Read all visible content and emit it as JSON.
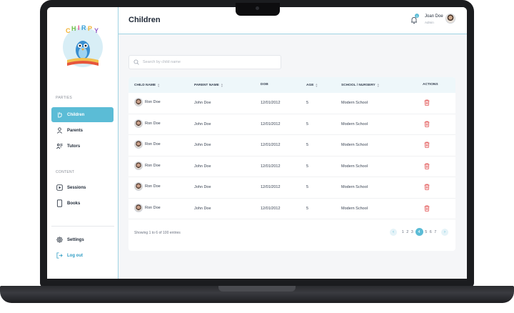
{
  "sidebar": {
    "sections": [
      {
        "label": "PARTIES"
      },
      {
        "label": "CONTENT"
      }
    ],
    "items": [
      {
        "label": "Children",
        "icon": "hand-icon",
        "active": true
      },
      {
        "label": "Parents",
        "icon": "parent-icon"
      },
      {
        "label": "Tutors",
        "icon": "tutor-icon"
      },
      {
        "label": "Sessions",
        "icon": "play-icon"
      },
      {
        "label": "Books",
        "icon": "book-icon"
      }
    ],
    "settings_label": "Settings",
    "logout_label": "Log out"
  },
  "header": {
    "title": "Children",
    "notification_count": "1",
    "user_name": "Joan Doe",
    "user_role": "Admin"
  },
  "search": {
    "placeholder": "Search by child name",
    "value": ""
  },
  "table": {
    "headers": [
      "CHILD NAME",
      "PARENT NAME",
      "DOB",
      "AGE",
      "SCHOOL / NURSERY",
      "ACTIONS"
    ],
    "rows": [
      {
        "child": "Ron Doe",
        "parent": "John Doe",
        "dob": "12/01/2012",
        "age": "5",
        "school": "Modern School"
      },
      {
        "child": "Ron Doe",
        "parent": "John Doe",
        "dob": "12/01/2012",
        "age": "5",
        "school": "Modern School"
      },
      {
        "child": "Ron Doe",
        "parent": "John Doe",
        "dob": "12/01/2012",
        "age": "5",
        "school": "Modern School"
      },
      {
        "child": "Ron Doe",
        "parent": "John Doe",
        "dob": "12/01/2012",
        "age": "5",
        "school": "Modern School"
      },
      {
        "child": "Ron Doe",
        "parent": "John Doe",
        "dob": "12/01/2012",
        "age": "5",
        "school": "Modern School"
      },
      {
        "child": "Ron Doe",
        "parent": "John Doe",
        "dob": "12/01/2012",
        "age": "5",
        "school": "Modern School"
      }
    ],
    "footer": "Showing 1 to 6 of 100 entries"
  },
  "pagination": {
    "prev": "‹",
    "next": "›",
    "pages": [
      "1",
      "2",
      "3",
      "4",
      "5",
      "6",
      "7"
    ],
    "current": "4"
  },
  "colors": {
    "accent": "#5bbcd6",
    "danger": "#e04a4a",
    "background": "#f5f6f8"
  }
}
